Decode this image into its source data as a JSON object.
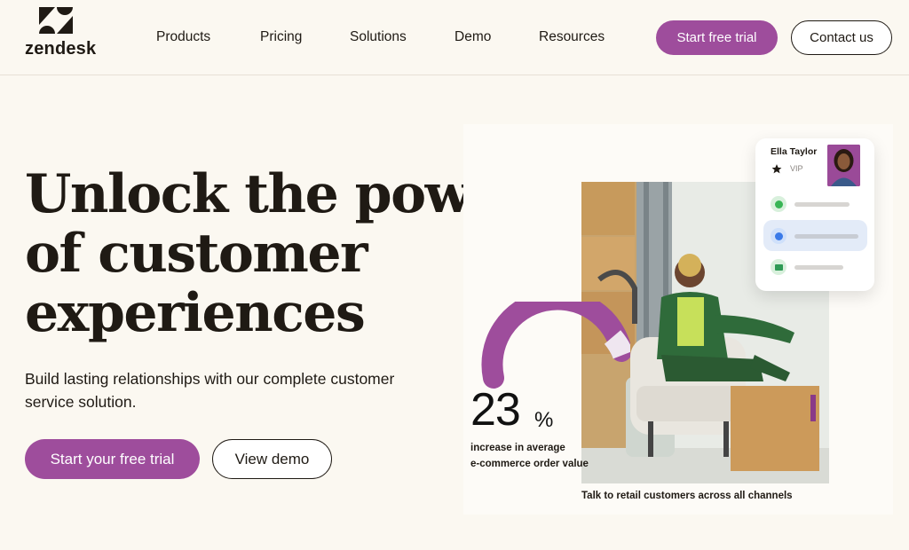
{
  "brand": {
    "name": "zendesk"
  },
  "nav": {
    "links": [
      "Products",
      "Pricing",
      "Solutions",
      "Demo",
      "Resources"
    ],
    "trial_label": "Start free trial",
    "contact_label": "Contact us"
  },
  "hero": {
    "title_line1": "Unlock the power",
    "title_line2": "of customer",
    "title_line3": "experiences",
    "subtitle": "Build lasting relationships with our complete customer service solution.",
    "primary_cta": "Start your free trial",
    "secondary_cta": "View demo"
  },
  "customer_card": {
    "name": "Ella Taylor",
    "tier": "VIP",
    "channels": [
      "whatsapp-icon",
      "messenger-icon",
      "email-icon"
    ]
  },
  "stat": {
    "value": "23",
    "unit": "%",
    "caption_line1": "increase in average",
    "caption_line2": "e-commerce order value"
  },
  "photo_caption": "Talk to retail customers across all channels",
  "colors": {
    "brand_purple": "#9e4d9c",
    "background": "#fbf8f1",
    "text": "#1f1a14"
  }
}
